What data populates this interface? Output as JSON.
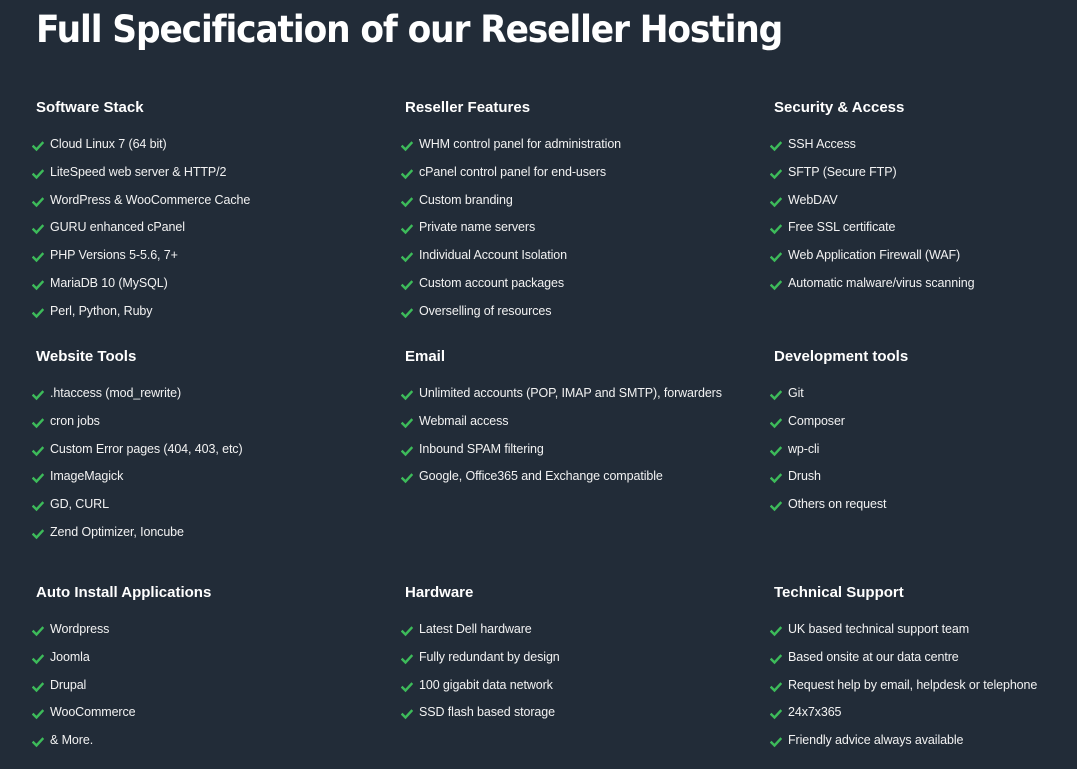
{
  "page": {
    "title": "Full Specification of our Reseller Hosting"
  },
  "colors": {
    "background": "#222c38",
    "check": "#3dbb5a",
    "text": "#ffffff"
  },
  "sections": [
    {
      "title": "Software Stack",
      "icon": "check-icon",
      "items": [
        "Cloud Linux 7 (64 bit)",
        "LiteSpeed web server & HTTP/2",
        "WordPress & WooCommerce Cache",
        "GURU enhanced cPanel",
        "PHP Versions 5-5.6, 7+",
        "MariaDB 10 (MySQL)",
        "Perl, Python, Ruby"
      ]
    },
    {
      "title": "Reseller Features",
      "icon": "check-icon",
      "items": [
        "WHM control panel for administration",
        "cPanel control panel for end-users",
        "Custom branding",
        "Private name servers",
        "Individual Account Isolation",
        "Custom account packages",
        "Overselling of resources"
      ]
    },
    {
      "title": "Security & Access",
      "icon": "check-icon",
      "items": [
        "SSH Access",
        "SFTP (Secure FTP)",
        "WebDAV",
        "Free SSL certificate",
        "Web Application Firewall (WAF)",
        "Automatic malware/virus scanning"
      ]
    },
    {
      "title": "Website Tools",
      "icon": "check-icon",
      "items": [
        ".htaccess (mod_rewrite)",
        "cron jobs",
        "Custom Error pages (404, 403, etc)",
        "ImageMagick",
        "GD, CURL",
        "Zend Optimizer, Ioncube"
      ]
    },
    {
      "title": "Email",
      "icon": "check-icon",
      "items": [
        "Unlimited accounts (POP, IMAP and SMTP), forwarders",
        "Webmail access",
        "Inbound SPAM filtering",
        "Google, Office365 and Exchange compatible"
      ]
    },
    {
      "title": "Development tools",
      "icon": "check-icon",
      "items": [
        "Git",
        "Composer",
        "wp-cli",
        "Drush",
        "Others on request"
      ]
    },
    {
      "title": "Auto Install Applications",
      "icon": "check-icon",
      "items": [
        "Wordpress",
        "Joomla",
        "Drupal",
        "WooCommerce",
        "& More."
      ]
    },
    {
      "title": "Hardware",
      "icon": "check-icon",
      "items": [
        "Latest Dell hardware",
        "Fully redundant by design",
        "100 gigabit data network",
        "SSD flash based storage"
      ]
    },
    {
      "title": "Technical Support",
      "icon": "check-icon",
      "items": [
        "UK based technical support team",
        "Based onsite at our data centre",
        "Request help by email, helpdesk or telephone",
        "24x7x365",
        "Friendly advice always available"
      ]
    }
  ]
}
